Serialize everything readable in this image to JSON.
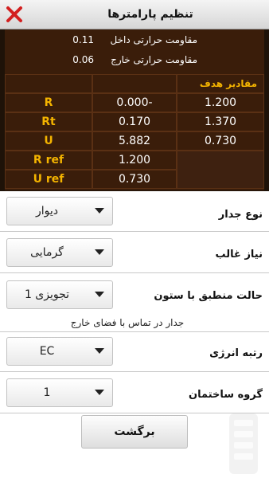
{
  "header": {
    "title": "تنظیم پارامترها"
  },
  "resistances": {
    "inner_label": "مقاومت حرارتی داخل",
    "inner_value": "0.11",
    "outer_label": "مقاومت حرارتی خارج",
    "outer_value": "0.06"
  },
  "table": {
    "target_header": "مقادیر هدف",
    "rows": [
      {
        "label": "R",
        "value": "0.000-",
        "target": "1.200"
      },
      {
        "label": "Rt",
        "value": "0.170",
        "target": "1.370"
      },
      {
        "label": "U",
        "value": "5.882",
        "target": "0.730"
      },
      {
        "label": "R ref",
        "value": "1.200",
        "target": ""
      },
      {
        "label": "U ref",
        "value": "0.730",
        "target": ""
      }
    ]
  },
  "form": {
    "wall_type": {
      "label": "نوع جدار",
      "value": "دیوار"
    },
    "dominant_need": {
      "label": "نیاز غالب",
      "value": "گرمایی"
    },
    "column_state": {
      "label": "حالت منطبق با ستون",
      "value": "تجویزی 1",
      "note": "جدار در تماس با فضای خارج"
    },
    "energy_rank": {
      "label": "رتبه انرژی",
      "value": "EC"
    },
    "building_group": {
      "label": "گروه ساختمان",
      "value": "1"
    }
  },
  "back_button": "برگشت",
  "colors": {
    "panel_bg": "#3a1d0a",
    "accent": "#f4b400",
    "close_red": "#d32020"
  },
  "icons": {
    "close": "close-icon",
    "dropdown": "chevron-down-icon"
  }
}
